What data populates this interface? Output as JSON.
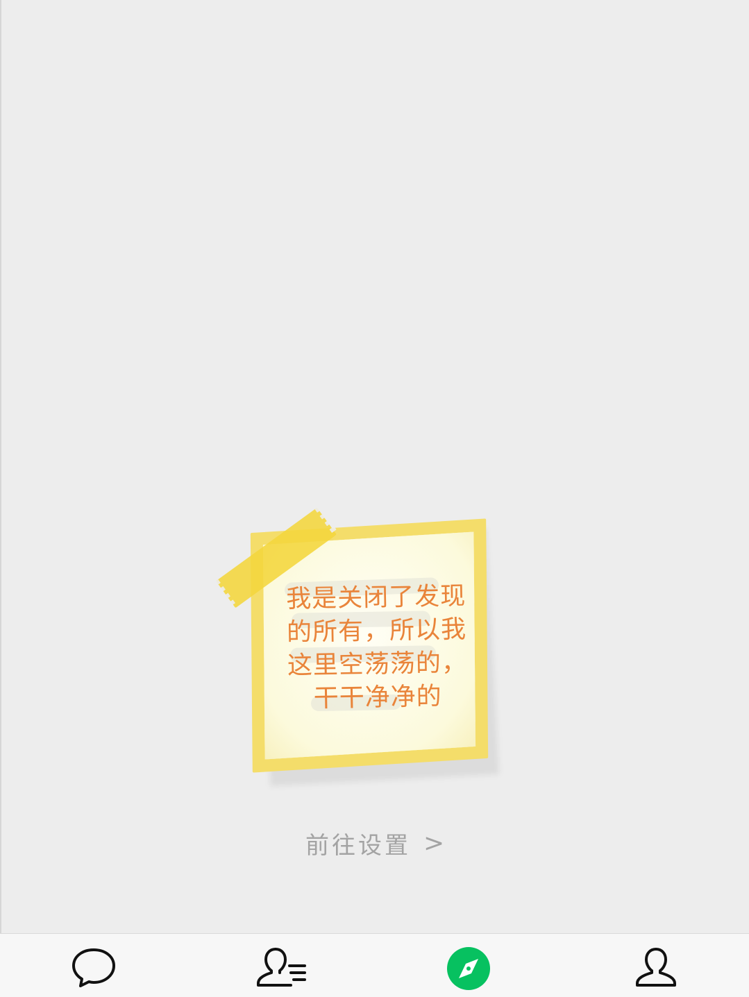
{
  "note": {
    "lines": [
      "我是关闭了发现",
      "的所有，所以我",
      "这里空荡荡的，",
      "干干净净的"
    ]
  },
  "settings_link": {
    "label": "前往设置",
    "chevron": ">"
  },
  "tabbar": {
    "tabs": [
      {
        "icon": "chat-bubble-icon",
        "active": false
      },
      {
        "icon": "contacts-icon",
        "active": false
      },
      {
        "icon": "compass-icon",
        "active": true
      },
      {
        "icon": "profile-icon",
        "active": false
      }
    ],
    "active_color": "#07c160",
    "inactive_color": "#111111"
  },
  "colors": {
    "background": "#ededed",
    "note_text": "#e9843a",
    "tape": "#f4d63c",
    "link_text": "#a3a3a3"
  }
}
